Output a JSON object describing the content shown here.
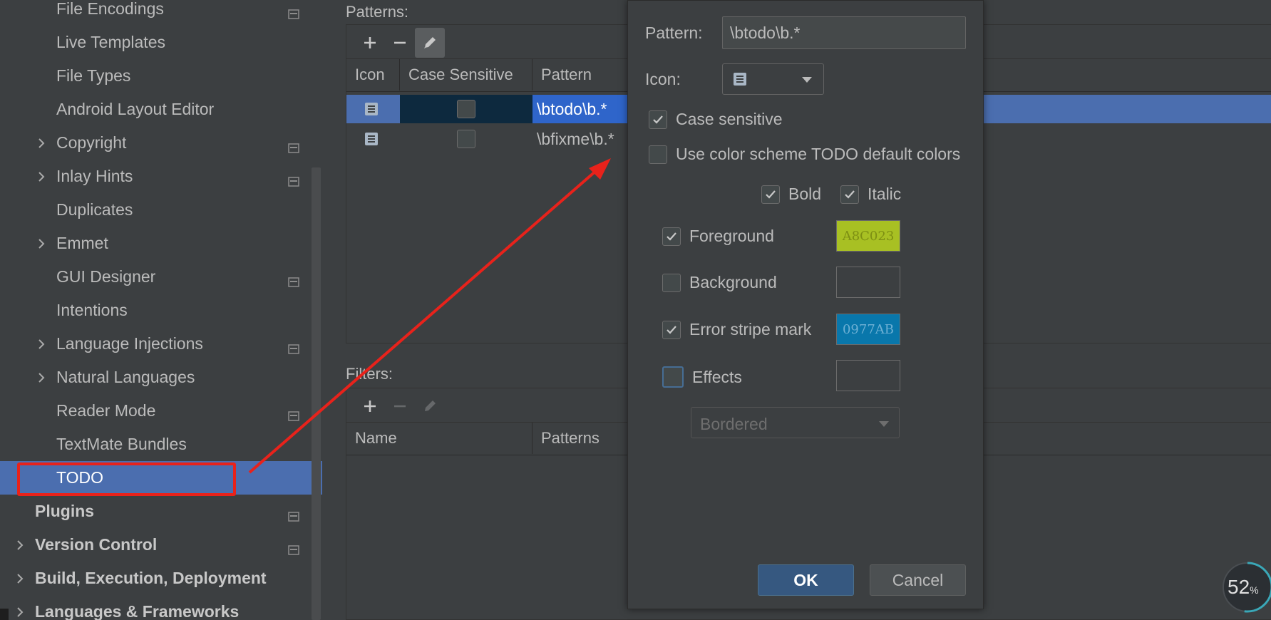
{
  "sidebar": {
    "items": [
      {
        "label": "File Encodings",
        "indent": 2,
        "has_chevron": false,
        "bold": false,
        "project_icon": true,
        "selected": false
      },
      {
        "label": "Live Templates",
        "indent": 2,
        "has_chevron": false,
        "bold": false,
        "project_icon": false,
        "selected": false
      },
      {
        "label": "File Types",
        "indent": 2,
        "has_chevron": false,
        "bold": false,
        "project_icon": false,
        "selected": false
      },
      {
        "label": "Android Layout Editor",
        "indent": 2,
        "has_chevron": false,
        "bold": false,
        "project_icon": false,
        "selected": false
      },
      {
        "label": "Copyright",
        "indent": 2,
        "has_chevron": true,
        "bold": false,
        "project_icon": true,
        "selected": false
      },
      {
        "label": "Inlay Hints",
        "indent": 2,
        "has_chevron": true,
        "bold": false,
        "project_icon": true,
        "selected": false
      },
      {
        "label": "Duplicates",
        "indent": 2,
        "has_chevron": false,
        "bold": false,
        "project_icon": false,
        "selected": false
      },
      {
        "label": "Emmet",
        "indent": 2,
        "has_chevron": true,
        "bold": false,
        "project_icon": false,
        "selected": false
      },
      {
        "label": "GUI Designer",
        "indent": 2,
        "has_chevron": false,
        "bold": false,
        "project_icon": true,
        "selected": false
      },
      {
        "label": "Intentions",
        "indent": 2,
        "has_chevron": false,
        "bold": false,
        "project_icon": false,
        "selected": false
      },
      {
        "label": "Language Injections",
        "indent": 2,
        "has_chevron": true,
        "bold": false,
        "project_icon": true,
        "selected": false
      },
      {
        "label": "Natural Languages",
        "indent": 2,
        "has_chevron": true,
        "bold": false,
        "project_icon": false,
        "selected": false
      },
      {
        "label": "Reader Mode",
        "indent": 2,
        "has_chevron": false,
        "bold": false,
        "project_icon": true,
        "selected": false
      },
      {
        "label": "TextMate Bundles",
        "indent": 2,
        "has_chevron": false,
        "bold": false,
        "project_icon": false,
        "selected": false
      },
      {
        "label": "TODO",
        "indent": 2,
        "has_chevron": false,
        "bold": false,
        "project_icon": false,
        "selected": true
      },
      {
        "label": "Plugins",
        "indent": 1,
        "has_chevron": false,
        "bold": true,
        "project_icon": true,
        "selected": false
      },
      {
        "label": "Version Control",
        "indent": 1,
        "has_chevron": true,
        "bold": true,
        "project_icon": true,
        "selected": false
      },
      {
        "label": "Build, Execution, Deployment",
        "indent": 1,
        "has_chevron": true,
        "bold": true,
        "project_icon": false,
        "selected": false
      },
      {
        "label": "Languages & Frameworks",
        "indent": 1,
        "has_chevron": true,
        "bold": true,
        "project_icon": false,
        "selected": false
      }
    ]
  },
  "patterns": {
    "title": "Patterns:",
    "toolbar": {
      "add": "add-icon",
      "remove": "remove-icon",
      "edit": "edit-icon"
    },
    "columns": [
      "Icon",
      "Case Sensitive",
      "Pattern"
    ],
    "rows": [
      {
        "pattern": "\\btodo\\b.*",
        "case_sensitive": false,
        "selected": true
      },
      {
        "pattern": "\\bfixme\\b.*",
        "case_sensitive": false,
        "selected": false
      }
    ]
  },
  "filters": {
    "title": "Filters:",
    "columns": [
      "Name",
      "Patterns"
    ]
  },
  "dialog": {
    "pattern_label": "Pattern:",
    "pattern_value": "\\btodo\\b.*",
    "icon_label": "Icon:",
    "case_sensitive_label": "Case sensitive",
    "case_sensitive_checked": true,
    "use_default_colors_label": "Use color scheme TODO default colors",
    "use_default_colors_checked": false,
    "bold_label": "Bold",
    "bold_checked": true,
    "italic_label": "Italic",
    "italic_checked": true,
    "foreground_label": "Foreground",
    "foreground_checked": true,
    "foreground_color": "A8C023",
    "background_label": "Background",
    "background_checked": false,
    "error_stripe_label": "Error stripe mark",
    "error_stripe_checked": true,
    "error_stripe_color": "0977AB",
    "effects_label": "Effects",
    "effects_checked": false,
    "effects_type": "Bordered",
    "ok_label": "OK",
    "cancel_label": "Cancel"
  },
  "perf_widget": {
    "value": "52",
    "unit": "%"
  },
  "colors": {
    "selection": "#4b6eaf",
    "annotation_red": "#e8221b",
    "foreground_swatch": "#A8C023",
    "error_stripe_swatch": "#0977AB"
  }
}
